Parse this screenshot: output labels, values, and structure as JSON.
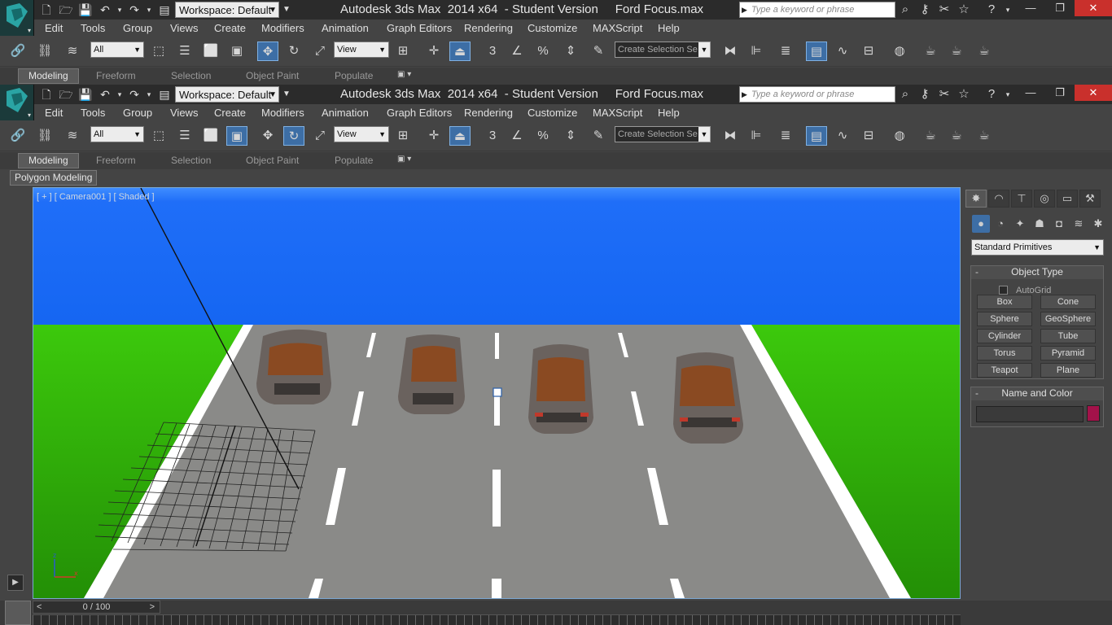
{
  "window": {
    "title": "Autodesk 3ds Max  2014 x64  - Student Version     Ford Focus.max",
    "workspace": "Workspace: Default",
    "search_placeholder": "Type a keyword or phrase",
    "minimize": "—",
    "restore": "❐",
    "close": "✕"
  },
  "menu": [
    "Edit",
    "Tools",
    "Group",
    "Views",
    "Create",
    "Modifiers",
    "Animation",
    "Graph Editors",
    "Rendering",
    "Customize",
    "MAXScript",
    "Help"
  ],
  "toolbar": {
    "selection_filter": "All",
    "reference_coord": "View",
    "named_selection": "Create Selection Se",
    "snap_3d": "3"
  },
  "ribbon": {
    "tabs": [
      "Modeling",
      "Freeform",
      "Selection",
      "Object Paint",
      "Populate"
    ],
    "active": "Modeling",
    "dropdown": "▣ ▾",
    "panel": "Polygon Modeling"
  },
  "viewport": {
    "label": "[ + ] [ Camera001 ] [ Shaded ]",
    "axis_x": "x",
    "axis_z": "z"
  },
  "command_panel": {
    "category": "Standard Primitives",
    "object_type_title": "Object Type",
    "autogrid": "AutoGrid",
    "buttons": [
      "Box",
      "Cone",
      "Sphere",
      "GeoSphere",
      "Cylinder",
      "Tube",
      "Torus",
      "Pyramid",
      "Teapot",
      "Plane"
    ],
    "name_color_title": "Name and Color",
    "object_color": "#a3124a",
    "collapse": "-"
  },
  "timeline": {
    "frame": "0 / 100",
    "prev": "<",
    "next": ">"
  }
}
